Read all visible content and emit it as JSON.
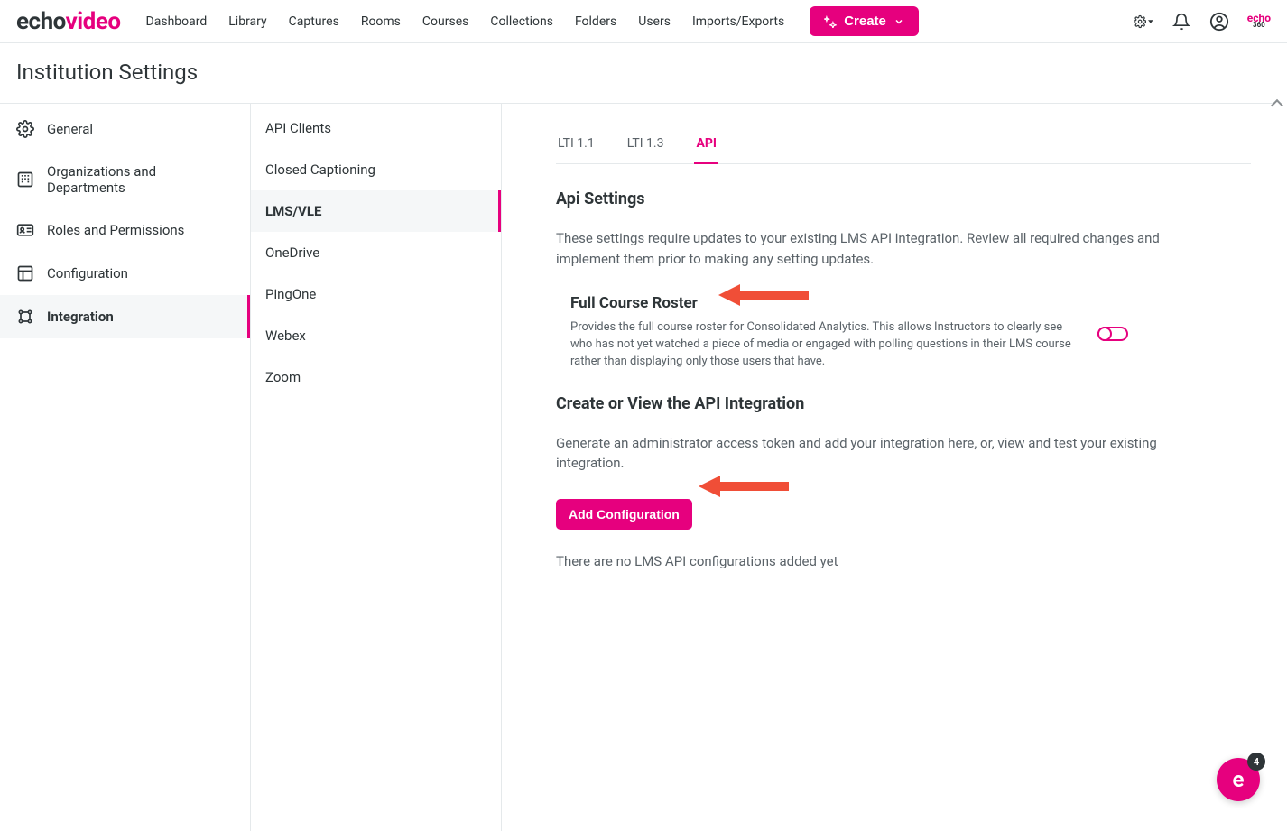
{
  "brand": {
    "part1": "echo",
    "part2": "video"
  },
  "topnav": {
    "links": [
      "Dashboard",
      "Library",
      "Captures",
      "Rooms",
      "Courses",
      "Collections",
      "Folders",
      "Users",
      "Imports/Exports"
    ],
    "create_label": "Create"
  },
  "mini_logo": {
    "top": "echo",
    "sub": "360"
  },
  "page_title": "Institution Settings",
  "settings_nav": [
    {
      "label": "General",
      "icon": "gear"
    },
    {
      "label": "Organizations and Departments",
      "icon": "building"
    },
    {
      "label": "Roles and Permissions",
      "icon": "id-card"
    },
    {
      "label": "Configuration",
      "icon": "layout"
    },
    {
      "label": "Integration",
      "icon": "integration",
      "active": true
    }
  ],
  "sub_nav": [
    {
      "label": "API Clients"
    },
    {
      "label": "Closed Captioning"
    },
    {
      "label": "LMS/VLE",
      "active": true
    },
    {
      "label": "OneDrive"
    },
    {
      "label": "PingOne"
    },
    {
      "label": "Webex"
    },
    {
      "label": "Zoom"
    }
  ],
  "tabs": [
    {
      "label": "LTI 1.1"
    },
    {
      "label": "LTI 1.3"
    },
    {
      "label": "API",
      "active": true
    }
  ],
  "api": {
    "heading": "Api Settings",
    "intro": "These settings require updates to your existing LMS API integration. Review all required changes and implement them prior to making any setting updates.",
    "roster_label": "Full Course Roster",
    "roster_help": "Provides the full course roster for Consolidated Analytics. This allows Instructors to clearly see who has not yet watched a piece of media or engaged with polling questions in their LMS course rather than displaying only those users that have.",
    "create_view_heading": "Create or View the API Integration",
    "create_view_desc": "Generate an administrator access token and add your integration here, or, view and test your existing integration.",
    "add_config_label": "Add Configuration",
    "empty_msg": "There are no LMS API configurations added yet"
  },
  "chat_badge": "4"
}
